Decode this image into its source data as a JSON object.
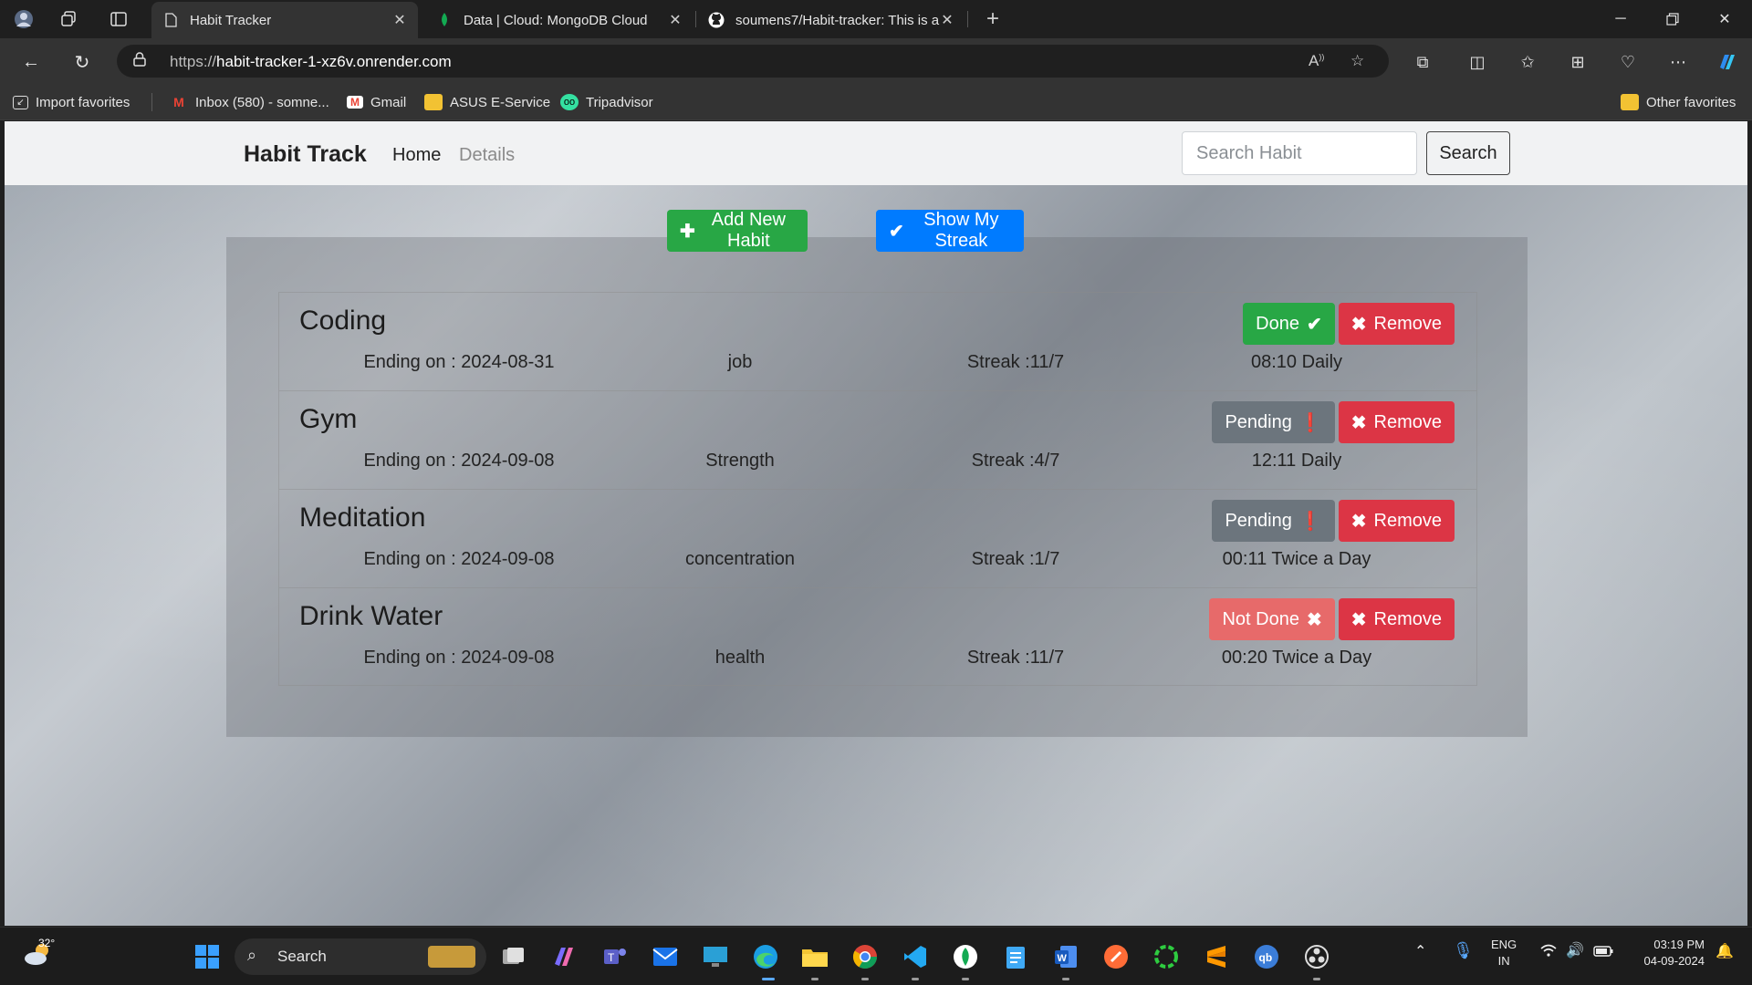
{
  "browser": {
    "tabs": [
      {
        "title": "Habit Tracker",
        "active": true
      },
      {
        "title": "Data | Cloud: MongoDB Cloud",
        "active": false
      },
      {
        "title": "soumens7/Habit-tracker: This is a",
        "active": false
      }
    ],
    "url_scheme": "https://",
    "url_host": "habit-tracker-1-xz6v.onrender.com",
    "favorites": [
      {
        "label": "Import favorites"
      },
      {
        "label": "Inbox (580) - somne..."
      },
      {
        "label": "Gmail"
      },
      {
        "label": "ASUS E-Service"
      },
      {
        "label": "Tripadvisor"
      }
    ],
    "other_favorites": "Other favorites"
  },
  "app": {
    "brand": "Habit Track",
    "nav": {
      "home": "Home",
      "details": "Details"
    },
    "search": {
      "placeholder": "Search Habit",
      "button": "Search"
    },
    "add_button": "Add New Habit",
    "streak_button": "Show My Streak",
    "habits": [
      {
        "name": "Coding",
        "ending": "Ending on : 2024-08-31",
        "category": "job",
        "streak": "Streak :11/7",
        "time": "08:10 Daily",
        "status": "Done",
        "status_color": "#28a745",
        "remove": "Remove"
      },
      {
        "name": "Gym",
        "ending": "Ending on : 2024-09-08",
        "category": "Strength",
        "streak": "Streak :4/7",
        "time": "12:11 Daily",
        "status": "Pending",
        "status_color": "#6c757d",
        "remove": "Remove"
      },
      {
        "name": "Meditation",
        "ending": "Ending on : 2024-09-08",
        "category": "concentration",
        "streak": "Streak :1/7",
        "time": "00:11 Twice a Day",
        "status": "Pending",
        "status_color": "#6c757d",
        "remove": "Remove"
      },
      {
        "name": "Drink Water",
        "ending": "Ending on : 2024-09-08",
        "category": "health",
        "streak": "Streak :11/7",
        "time": "00:20 Twice a Day",
        "status": "Not Done",
        "status_color": "#e76a6a",
        "remove": "Remove"
      }
    ]
  },
  "taskbar": {
    "temperature": "32°",
    "search": "Search",
    "lang_1": "ENG",
    "lang_2": "IN",
    "time": "03:19 PM",
    "date": "04-09-2024"
  }
}
